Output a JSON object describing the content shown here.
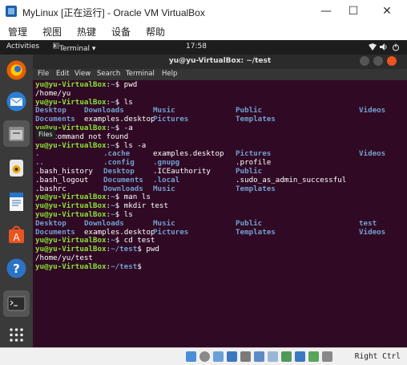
{
  "window": {
    "title": "MyLinux [正在运行] - Oracle VM VirtualBox",
    "controls": {
      "minimize": "—",
      "maximize": "☐",
      "close": "✕"
    }
  },
  "host_menu": [
    "管理",
    "视图",
    "热键",
    "设备",
    "帮助"
  ],
  "topbar": {
    "activities": "Activities",
    "app": "Terminal ▾",
    "clock": "17:58"
  },
  "dock": {
    "tooltip": "Files"
  },
  "terminal": {
    "title": "yu@yu-VirtualBox: ~/test",
    "menu": [
      "File",
      "Edit",
      "View",
      "Search",
      "Terminal",
      "Help"
    ],
    "prompt_user": "yu@yu-VirtualBox",
    "lines": [
      {
        "prompt": true,
        "path": "~",
        "cmd": " pwd"
      },
      {
        "text": "/home/yu"
      },
      {
        "prompt": true,
        "path": "~",
        "cmd": " ls"
      },
      {
        "cols": [
          [
            "Desktop",
            true
          ],
          [
            "Downloads",
            true
          ],
          [
            "Music",
            true
          ],
          [
            "Public",
            true
          ],
          [
            "Videos",
            true
          ]
        ]
      },
      {
        "cols": [
          [
            "Documents",
            true
          ],
          [
            "examples.desktop",
            false
          ],
          [
            "Pictures",
            true
          ],
          [
            "Templates",
            true
          ]
        ]
      },
      {
        "prompt": true,
        "path": "~",
        "cmd": " -a"
      },
      {
        "text": "-a: command not found"
      },
      {
        "prompt": true,
        "path": "~",
        "cmd": " ls -a"
      },
      {
        "cols": [
          [
            ".",
            true
          ],
          [
            ".cache",
            true
          ],
          [
            "examples.desktop",
            false
          ],
          [
            "Pictures",
            true
          ],
          [
            "Videos",
            true
          ]
        ]
      },
      {
        "cols": [
          [
            "..",
            true
          ],
          [
            ".config",
            true
          ],
          [
            ".gnupg",
            true
          ],
          [
            ".profile",
            false
          ]
        ]
      },
      {
        "cols": [
          [
            ".bash_history",
            false
          ],
          [
            "Desktop",
            true
          ],
          [
            ".ICEauthority",
            false
          ],
          [
            "Public",
            true
          ]
        ]
      },
      {
        "cols": [
          [
            ".bash_logout",
            false
          ],
          [
            "Documents",
            true
          ],
          [
            ".local",
            true
          ],
          [
            ".sudo_as_admin_successful",
            false
          ]
        ]
      },
      {
        "cols": [
          [
            ".bashrc",
            false
          ],
          [
            "Downloads",
            true
          ],
          [
            "Music",
            true
          ],
          [
            "Templates",
            true
          ]
        ]
      },
      {
        "prompt": true,
        "path": "~",
        "cmd": " man ls"
      },
      {
        "prompt": true,
        "path": "~",
        "cmd": " mkdir test"
      },
      {
        "prompt": true,
        "path": "~",
        "cmd": " ls"
      },
      {
        "cols": [
          [
            "Desktop",
            true
          ],
          [
            "Downloads",
            true
          ],
          [
            "Music",
            true
          ],
          [
            "Public",
            true
          ],
          [
            "test",
            true
          ]
        ]
      },
      {
        "cols": [
          [
            "Documents",
            true
          ],
          [
            "examples.desktop",
            false
          ],
          [
            "Pictures",
            true
          ],
          [
            "Templates",
            true
          ],
          [
            "Videos",
            true
          ]
        ]
      },
      {
        "prompt": true,
        "path": "~",
        "cmd": " cd test"
      },
      {
        "prompt": true,
        "path": "~/test",
        "cmd": " pwd"
      },
      {
        "text": "/home/yu/test"
      },
      {
        "prompt": true,
        "path": "~/test",
        "cmd": ""
      }
    ]
  },
  "statusbar": {
    "host_key": "Right Ctrl"
  },
  "colors": {
    "terminal_bg": "#300a24",
    "prompt_user": "#8ae234",
    "prompt_path": "#729fcf",
    "dock_bg": "#3a3a3a"
  }
}
